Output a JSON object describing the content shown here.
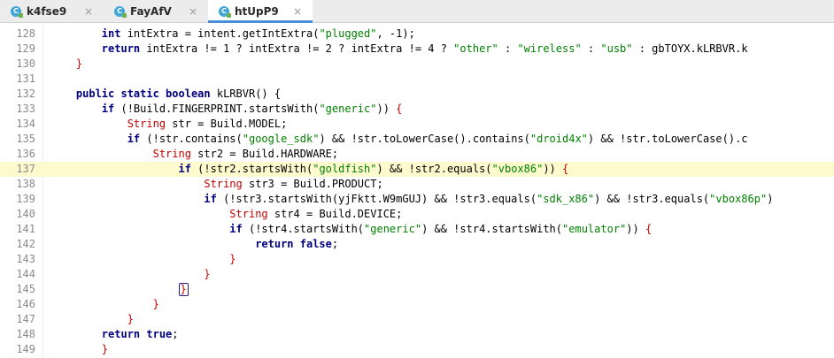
{
  "tabs": [
    {
      "icon": "C",
      "label": "k4fse9",
      "close": "×",
      "active": false
    },
    {
      "icon": "C",
      "label": "FayAfV",
      "close": "×",
      "active": false
    },
    {
      "icon": "C",
      "label": "htUpP9",
      "close": "×",
      "active": true
    }
  ],
  "editor": {
    "highlighted_line": "137",
    "lines": [
      {
        "num": "128",
        "indent": "        ",
        "tokens": [
          [
            "kw",
            "int"
          ],
          [
            "t",
            " intExtra = intent.getIntExtra("
          ],
          [
            "s",
            "\"plugged\""
          ],
          [
            "t",
            ", -1);"
          ]
        ]
      },
      {
        "num": "129",
        "indent": "        ",
        "tokens": [
          [
            "kw",
            "return"
          ],
          [
            "t",
            " intExtra != 1 ? intExtra != 2 ? intExtra != 4 ? "
          ],
          [
            "s",
            "\"other\""
          ],
          [
            "t",
            " : "
          ],
          [
            "s",
            "\"wireless\""
          ],
          [
            "t",
            " : "
          ],
          [
            "s",
            "\"usb\""
          ],
          [
            "t",
            " : gbTOYX.kLRBVR.k"
          ]
        ]
      },
      {
        "num": "130",
        "indent": "    ",
        "tokens": [
          [
            "b",
            "}"
          ]
        ]
      },
      {
        "num": "131",
        "indent": "",
        "tokens": []
      },
      {
        "num": "132",
        "indent": "    ",
        "tokens": [
          [
            "kw",
            "public static boolean"
          ],
          [
            "t",
            " kLRBVR() {"
          ]
        ]
      },
      {
        "num": "133",
        "indent": "        ",
        "tokens": [
          [
            "kw",
            "if"
          ],
          [
            "t",
            " (!Build.FINGERPRINT.startsWith("
          ],
          [
            "s",
            "\"generic\""
          ],
          [
            "t",
            ")) "
          ],
          [
            "b",
            "{"
          ]
        ]
      },
      {
        "num": "134",
        "indent": "            ",
        "tokens": [
          [
            "s2",
            "String"
          ],
          [
            "t",
            " str = Build.MODEL;"
          ]
        ]
      },
      {
        "num": "135",
        "indent": "            ",
        "tokens": [
          [
            "kw",
            "if"
          ],
          [
            "t",
            " (!str.contains("
          ],
          [
            "s",
            "\"google_sdk\""
          ],
          [
            "t",
            ") && !str.toLowerCase().contains("
          ],
          [
            "s",
            "\"droid4x\""
          ],
          [
            "t",
            ") && !str.toLowerCase().c"
          ]
        ]
      },
      {
        "num": "136",
        "indent": "                ",
        "tokens": [
          [
            "s2",
            "String"
          ],
          [
            "t",
            " str2 = Build.HARDWARE;"
          ]
        ]
      },
      {
        "num": "137",
        "indent": "                    ",
        "tokens": [
          [
            "kw",
            "if"
          ],
          [
            "t",
            " (!str2.startsWith("
          ],
          [
            "s",
            "\"goldfish\""
          ],
          [
            "t",
            ") && !str2.equals("
          ],
          [
            "s",
            "\"vbox86\""
          ],
          [
            "t",
            ")) "
          ],
          [
            "b",
            "{"
          ]
        ]
      },
      {
        "num": "138",
        "indent": "                        ",
        "tokens": [
          [
            "s2",
            "String"
          ],
          [
            "t",
            " str3 = Build.PRODUCT;"
          ]
        ]
      },
      {
        "num": "139",
        "indent": "                        ",
        "tokens": [
          [
            "kw",
            "if"
          ],
          [
            "t",
            " (!str3.startsWith(yjFktt.W9mGUJ) && !str3.equals("
          ],
          [
            "s",
            "\"sdk_x86\""
          ],
          [
            "t",
            ") && !str3.equals("
          ],
          [
            "s",
            "\"vbox86p\""
          ],
          [
            "t",
            ")"
          ]
        ]
      },
      {
        "num": "140",
        "indent": "                            ",
        "tokens": [
          [
            "s2",
            "String"
          ],
          [
            "t",
            " str4 = Build.DEVICE;"
          ]
        ]
      },
      {
        "num": "141",
        "indent": "                            ",
        "tokens": [
          [
            "kw",
            "if"
          ],
          [
            "t",
            " (!str4.startsWith("
          ],
          [
            "s",
            "\"generic\""
          ],
          [
            "t",
            ") && !str4.startsWith("
          ],
          [
            "s",
            "\"emulator\""
          ],
          [
            "t",
            ")) "
          ],
          [
            "b",
            "{"
          ]
        ]
      },
      {
        "num": "142",
        "indent": "                                ",
        "tokens": [
          [
            "kw",
            "return false"
          ],
          [
            "t",
            ";"
          ]
        ]
      },
      {
        "num": "143",
        "indent": "                            ",
        "tokens": [
          [
            "b",
            "}"
          ]
        ]
      },
      {
        "num": "144",
        "indent": "                        ",
        "tokens": [
          [
            "b",
            "}"
          ]
        ]
      },
      {
        "num": "145",
        "indent": "                    ",
        "tokens": [
          [
            "cb",
            "}"
          ]
        ]
      },
      {
        "num": "146",
        "indent": "                ",
        "tokens": [
          [
            "b",
            "}"
          ]
        ]
      },
      {
        "num": "147",
        "indent": "            ",
        "tokens": [
          [
            "b",
            "}"
          ]
        ]
      },
      {
        "num": "148",
        "indent": "        ",
        "tokens": [
          [
            "kw",
            "return true"
          ],
          [
            "t",
            ";"
          ]
        ]
      },
      {
        "num": "149",
        "indent": "        ",
        "tokens": [
          [
            "b",
            "}"
          ]
        ]
      }
    ]
  },
  "colors": {
    "keyword": "#000080",
    "string": "#008000",
    "type": "#c00000",
    "brace": "#c80000",
    "highlight": "#fdfbce",
    "tab_accent": "#4a90d9"
  }
}
